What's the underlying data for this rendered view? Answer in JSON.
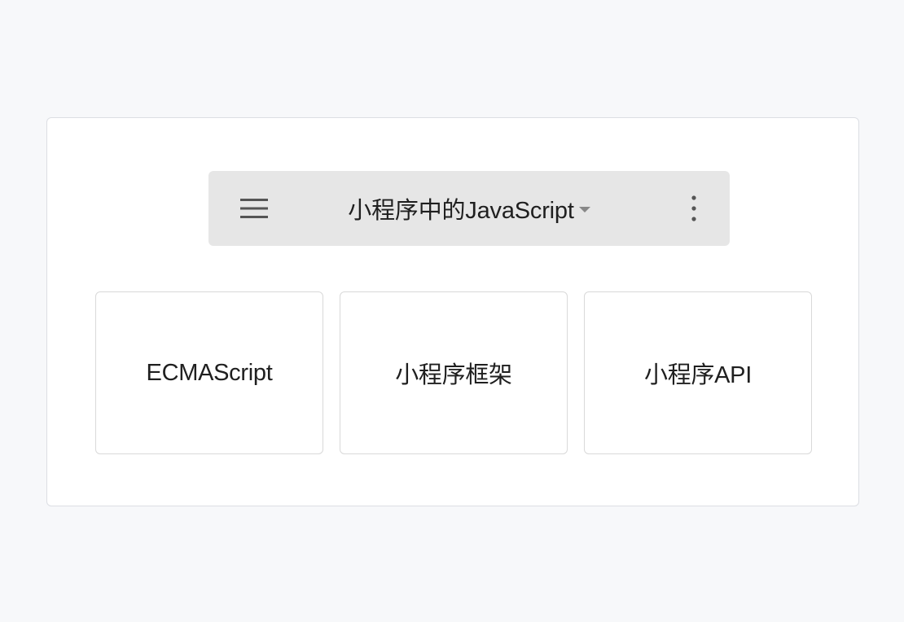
{
  "toolbar": {
    "menu_icon": "hamburger-menu-icon",
    "title": "小程序中的JavaScript",
    "dropdown_icon": "caret-down-icon",
    "more_icon": "more-vertical-icon"
  },
  "tiles": [
    {
      "label": "ECMAScript"
    },
    {
      "label": "小程序框架"
    },
    {
      "label": "小程序API"
    }
  ],
  "colors": {
    "page_background": "#f7f8fa",
    "card_background": "#ffffff",
    "card_border": "#dcdee3",
    "toolbar_background": "#e6e6e6",
    "tile_border": "#d9d9d9",
    "icon_color": "#555555",
    "text_color": "#1f1f1f"
  }
}
